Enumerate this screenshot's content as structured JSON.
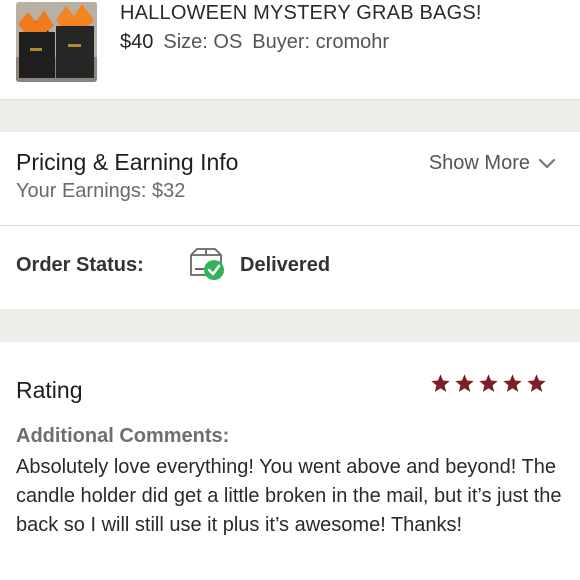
{
  "item": {
    "title": "HALLOWEEN MYSTERY GRAB BAGS!",
    "price": "$40",
    "size_label": "Size: OS",
    "buyer_label": "Buyer: cromohr",
    "thumbnail_icon": "product-photo"
  },
  "pricing": {
    "title": "Pricing & Earning Info",
    "earnings": "Your Earnings: $32",
    "show_more": "Show More"
  },
  "order_status": {
    "label": "Order Status:",
    "value": "Delivered",
    "icon": "box-check-icon"
  },
  "rating": {
    "title": "Rating",
    "stars": 5,
    "max_stars": 5,
    "star_color": "#7e1f28",
    "comments_label": "Additional Comments:",
    "comments": "Absolutely love everything! You went above and beyond! The candle holder did get a little broken in the mail, but it’s just the back so I will still use it plus it’s awesome! Thanks!"
  },
  "colors": {
    "separator": "#eeece8",
    "check_green": "#2fb457"
  }
}
